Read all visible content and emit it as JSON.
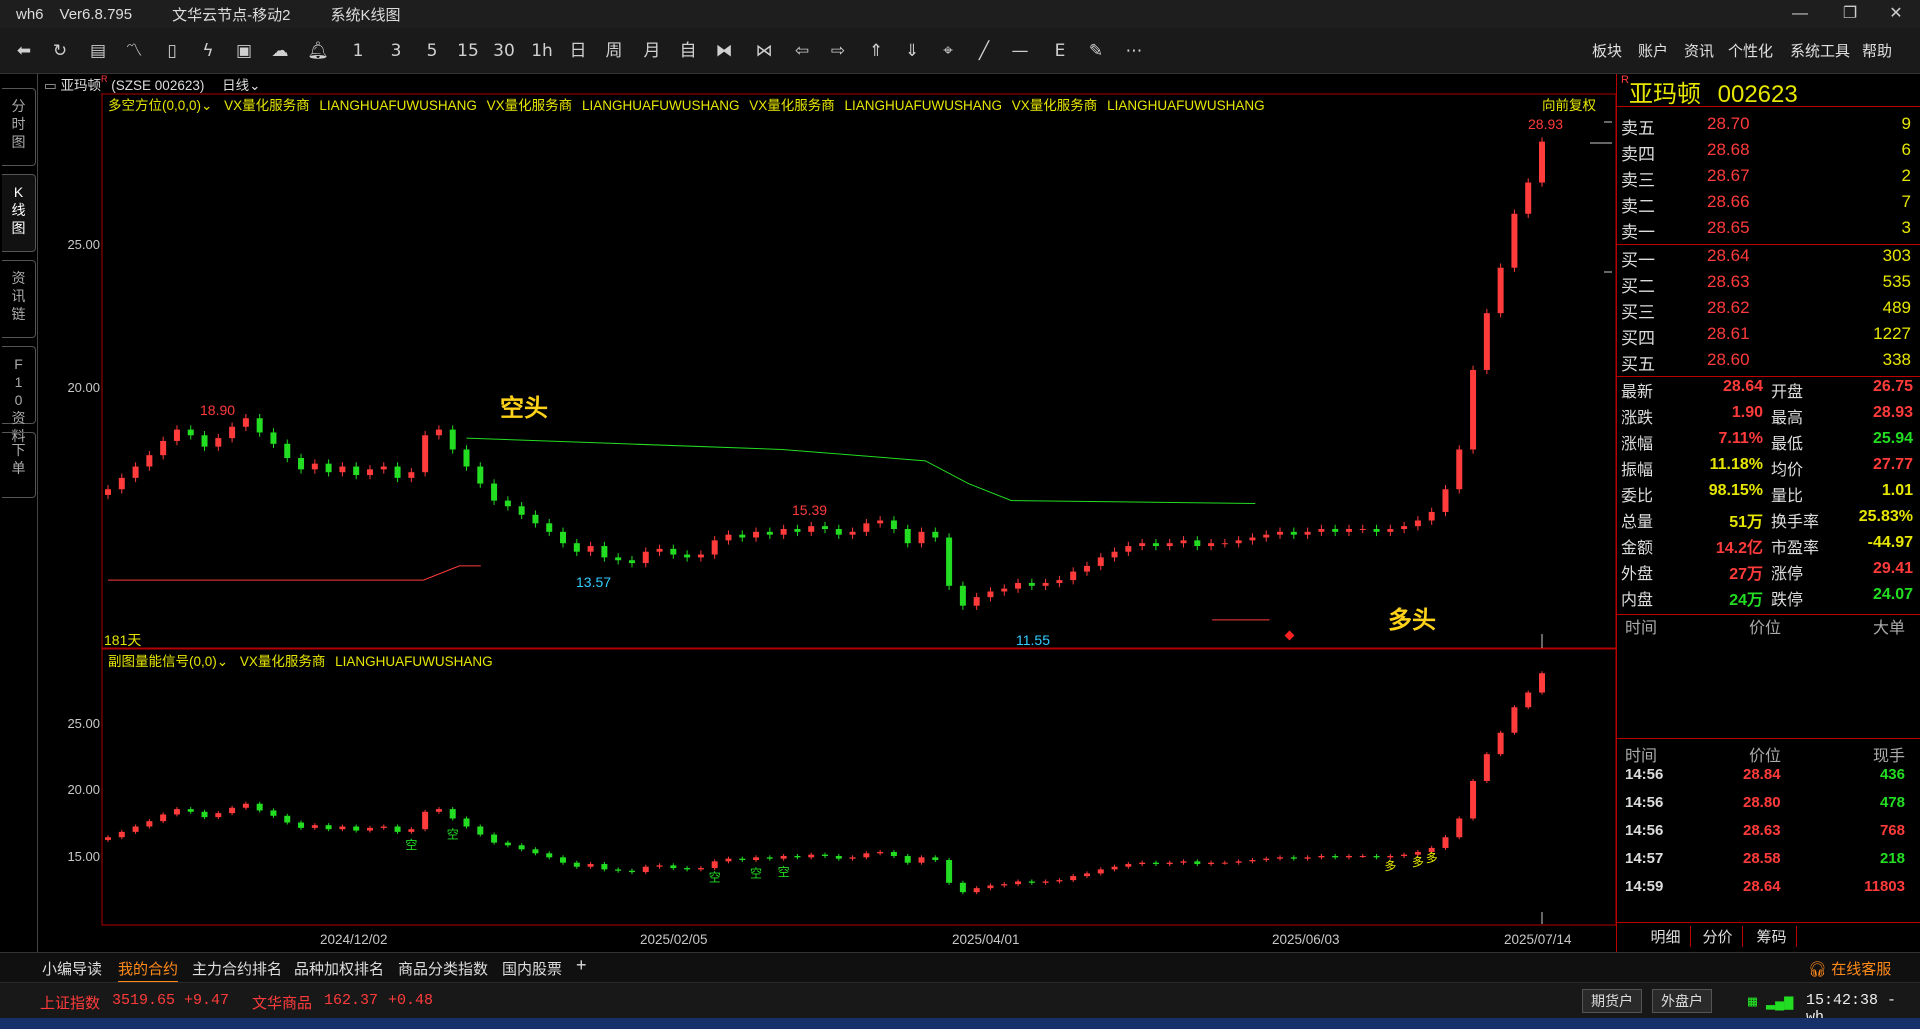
{
  "titlebar": {
    "app": "wh6",
    "version": "Ver6.8.795",
    "node": "文华云节点-移动2",
    "view": "系统K线图"
  },
  "toolbar": {
    "nums": [
      "1",
      "3",
      "5",
      "15",
      "30",
      "1h",
      "日",
      "周",
      "月",
      "自"
    ],
    "menus": [
      "板块",
      "账户",
      "资讯",
      "个性化",
      "系统工具",
      "帮助"
    ]
  },
  "sidebar": {
    "tabs": [
      "分时图",
      "K线图",
      "资讯链",
      "F10资料",
      "下单"
    ]
  },
  "symbol_bar": {
    "name": "亚玛顿",
    "code": "(SZSE 002623)",
    "period": "日线"
  },
  "main_chart": {
    "indicator": "多空方位(0,0,0)",
    "vendor_repeat": [
      "VX量化服务商",
      "LIANGHUAFUWUSHANG",
      "VX量化服务商",
      "LIANGHUAFUWUSHANG",
      "VX量化服务商",
      "LIANGHUAFUWUSHANG",
      "VX量化服务商",
      "LIANGHUAFUWUSHANG"
    ],
    "adjust": "向前复权",
    "days": "181天",
    "bear_label": "空头",
    "bull_label": "多头",
    "y_ticks": [
      "25.00",
      "20.00"
    ],
    "annotations": {
      "high1": "18.90",
      "high2": "15.39",
      "low1": "13.57",
      "low2": "11.55",
      "last_high": "28.93"
    }
  },
  "sub_chart": {
    "indicator": "副图量能信号(0,0)",
    "vendor": [
      "VX量化服务商",
      "LIANGHUAFUWUSHANG"
    ],
    "y_ticks": [
      "25.00",
      "20.00",
      "15.00"
    ],
    "signal_sell": "空",
    "signal_buy": "多"
  },
  "x_axis": [
    "2024/12/02",
    "2025/02/05",
    "2025/04/01",
    "2025/06/03",
    "2025/07/14"
  ],
  "chart_data": {
    "type": "candlestick",
    "title": "亚玛顿 (SZSE 002623) 日线",
    "ylim": [
      11,
      29.5
    ],
    "x_labels": [
      "2024/12/02",
      "2025/02/05",
      "2025/04/01",
      "2025/06/03",
      "2025/07/14"
    ],
    "closes": [
      16.4,
      16.8,
      17.2,
      17.6,
      18.1,
      18.5,
      18.3,
      17.9,
      18.2,
      18.6,
      18.9,
      18.4,
      18.0,
      17.5,
      17.1,
      17.3,
      17.0,
      17.2,
      16.9,
      17.1,
      17.2,
      16.8,
      17.0,
      18.3,
      18.5,
      17.8,
      17.2,
      16.6,
      16.0,
      15.8,
      15.5,
      15.2,
      14.9,
      14.5,
      14.2,
      14.4,
      14.0,
      13.9,
      13.8,
      14.2,
      14.3,
      14.1,
      14.0,
      14.1,
      14.6,
      14.8,
      14.7,
      14.9,
      14.8,
      15.0,
      14.9,
      15.1,
      15.0,
      14.8,
      14.9,
      15.2,
      15.3,
      15.0,
      14.5,
      14.9,
      14.7,
      13.0,
      12.3,
      12.6,
      12.8,
      12.9,
      13.1,
      13.0,
      13.1,
      13.2,
      13.5,
      13.7,
      14.0,
      14.2,
      14.4,
      14.5,
      14.4,
      14.5,
      14.6,
      14.4,
      14.5,
      14.5,
      14.6,
      14.7,
      14.8,
      14.9,
      14.8,
      14.9,
      15.0,
      14.9,
      15.0,
      15.0,
      14.9,
      15.0,
      15.1,
      15.3,
      15.6,
      16.4,
      17.8,
      20.6,
      22.6,
      24.2,
      26.1,
      27.2,
      28.64
    ],
    "long_short_line": {
      "bear": 18.2,
      "bull": 11.8
    }
  },
  "quote": {
    "name": "亚玛顿",
    "code": "002623",
    "flag": "R",
    "asks": [
      [
        "卖五",
        "28.70",
        "9"
      ],
      [
        "卖四",
        "28.68",
        "6"
      ],
      [
        "卖三",
        "28.67",
        "2"
      ],
      [
        "卖二",
        "28.66",
        "7"
      ],
      [
        "卖一",
        "28.65",
        "3"
      ]
    ],
    "bids": [
      [
        "买一",
        "28.64",
        "303"
      ],
      [
        "买二",
        "28.63",
        "535"
      ],
      [
        "买三",
        "28.62",
        "489"
      ],
      [
        "买四",
        "28.61",
        "1227"
      ],
      [
        "买五",
        "28.60",
        "338"
      ]
    ],
    "stats_left": [
      [
        "最新",
        "28.64",
        "red"
      ],
      [
        "涨跌",
        "1.90",
        "red"
      ],
      [
        "涨幅",
        "7.11%",
        "red"
      ],
      [
        "振幅",
        "11.18%",
        "yellow"
      ],
      [
        "委比",
        "98.15%",
        "yellow"
      ],
      [
        "总量",
        "51万",
        "yellow"
      ],
      [
        "金额",
        "14.2亿",
        "red"
      ],
      [
        "外盘",
        "27万",
        "red"
      ],
      [
        "内盘",
        "24万",
        "green"
      ]
    ],
    "stats_right": [
      [
        "开盘",
        "26.75",
        "red"
      ],
      [
        "最高",
        "28.93",
        "red"
      ],
      [
        "最低",
        "25.94",
        "green"
      ],
      [
        "均价",
        "27.77",
        "red"
      ],
      [
        "量比",
        "1.01",
        "yellow"
      ],
      [
        "换手率",
        "25.83%",
        "yellow"
      ],
      [
        "市盈率",
        "-44.97",
        "yellow"
      ],
      [
        "涨停",
        "29.41",
        "red"
      ],
      [
        "跌停",
        "24.07",
        "green"
      ]
    ],
    "bigorder_headers": [
      "时间",
      "价位",
      "大单"
    ],
    "tick_headers": [
      "时间",
      "价位",
      "现手"
    ],
    "ticks": [
      [
        "14:56",
        "28.84",
        "436",
        "green"
      ],
      [
        "14:56",
        "28.80",
        "478",
        "green"
      ],
      [
        "14:56",
        "28.63",
        "768",
        "red"
      ],
      [
        "14:57",
        "28.58",
        "218",
        "green"
      ],
      [
        "14:59",
        "28.64",
        "11803",
        "red"
      ]
    ],
    "bottom_tabs": [
      "明细",
      "分价",
      "筹码"
    ]
  },
  "bottom_tabs": [
    "小编导读",
    "我的合约",
    "主力合约排名",
    "品种加权排名",
    "商品分类指数",
    "国内股票"
  ],
  "statusbar": {
    "index1_name": "上证指数",
    "index1_val": "3519.65",
    "index1_chg": "+9.47",
    "index2_name": "文华商品",
    "index2_val": "162.37",
    "index2_chg": "+0.48",
    "btn1": "期货户",
    "btn2": "外盘户",
    "time": "15:42:38 - wh",
    "service": "在线客服"
  },
  "colors": {
    "up": "#ff3b3b",
    "down": "#22dd22",
    "label": "#e6e600",
    "frame": "#b00000"
  }
}
